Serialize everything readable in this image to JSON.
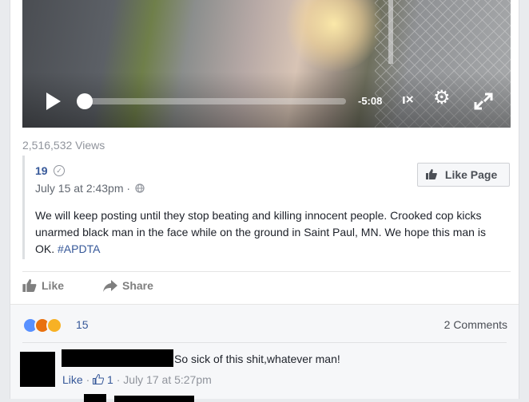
{
  "video": {
    "time_remaining": "-5:08",
    "mute_label": "ı×",
    "progress": 0.0
  },
  "views": "2,516,532 Views",
  "shared_post": {
    "page_name": "19",
    "date": "July 15 at 2:43pm ·",
    "like_page_label": "Like Page",
    "body": "We will keep posting until they stop beating and killing innocent people. Crooked cop kicks unarmed black man in the face while on the ground in Saint Paul, MN. We hope this man is OK.",
    "hashtag": "#APDTA"
  },
  "actions": {
    "like": "Like",
    "share": "Share"
  },
  "feedback": {
    "reaction_count": "15",
    "comments_count": "2 Comments"
  },
  "comment": {
    "text": "So sick of this shit,whatever man!",
    "like_label": "Like",
    "separator1": "·",
    "likes": "1",
    "separator2": "·",
    "timestamp": "July 17 at 5:27pm"
  }
}
